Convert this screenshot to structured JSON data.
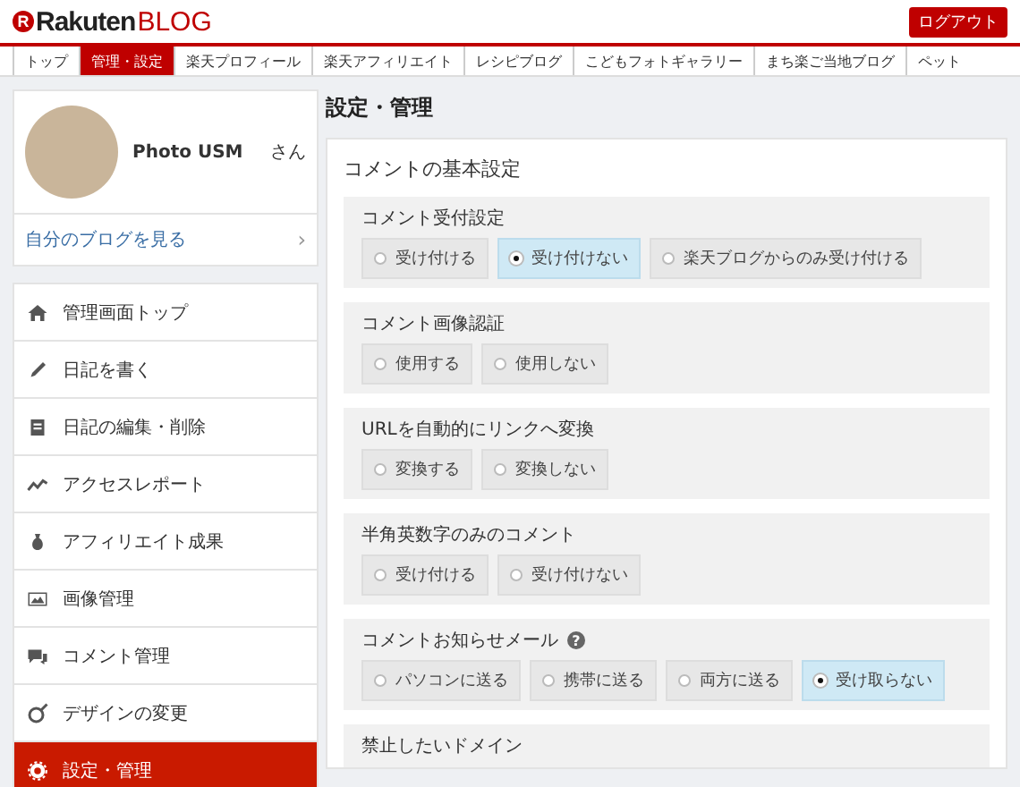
{
  "header": {
    "logo": {
      "mark": "R",
      "brand": "Rakuten",
      "product": "BLOG"
    },
    "logout": "ログアウト"
  },
  "nav": [
    {
      "label": "トップ",
      "selected": false
    },
    {
      "label": "管理・設定",
      "selected": true
    },
    {
      "label": "楽天プロフィール",
      "selected": false
    },
    {
      "label": "楽天アフィリエイト",
      "selected": false
    },
    {
      "label": "レシピブログ",
      "selected": false
    },
    {
      "label": "こどもフォトギャラリー",
      "selected": false
    },
    {
      "label": "まち楽ご当地ブログ",
      "selected": false
    },
    {
      "label": "ペット",
      "selected": false
    }
  ],
  "profile": {
    "name": "Photo USM",
    "suffix": "さん",
    "link": "自分のブログを見る",
    "chevron": "›"
  },
  "menu": [
    {
      "label": "管理画面トップ",
      "selected": false
    },
    {
      "label": "日記を書く",
      "selected": false
    },
    {
      "label": "日記の編集・削除",
      "selected": false
    },
    {
      "label": "アクセスレポート",
      "selected": false
    },
    {
      "label": "アフィリエイト成果",
      "selected": false
    },
    {
      "label": "画像管理",
      "selected": false
    },
    {
      "label": "コメント管理",
      "selected": false
    },
    {
      "label": "デザインの変更",
      "selected": false
    },
    {
      "label": "設定・管理",
      "selected": true
    }
  ],
  "page_title": "設定・管理",
  "card": {
    "title": "コメントの基本設定",
    "sections": [
      {
        "title": "コメント受付設定",
        "options": [
          {
            "label": "受け付ける",
            "selected": false
          },
          {
            "label": "受け付けない",
            "selected": true
          },
          {
            "label": "楽天ブログからのみ受け付ける",
            "selected": false
          }
        ]
      },
      {
        "title": "コメント画像認証",
        "options": [
          {
            "label": "使用する",
            "selected": false
          },
          {
            "label": "使用しない",
            "selected": false
          }
        ]
      },
      {
        "title": "URLを自動的にリンクへ変換",
        "options": [
          {
            "label": "変換する",
            "selected": false
          },
          {
            "label": "変換しない",
            "selected": false
          }
        ]
      },
      {
        "title": "半角英数字のみのコメント",
        "options": [
          {
            "label": "受け付ける",
            "selected": false
          },
          {
            "label": "受け付けない",
            "selected": false
          }
        ]
      },
      {
        "title": "コメントお知らせメール",
        "help": "?",
        "options": [
          {
            "label": "パソコンに送る",
            "selected": false
          },
          {
            "label": "携帯に送る",
            "selected": false
          },
          {
            "label": "両方に送る",
            "selected": false
          },
          {
            "label": "受け取らない",
            "selected": true
          }
        ]
      },
      {
        "title": "禁止したいドメイン"
      }
    ]
  }
}
